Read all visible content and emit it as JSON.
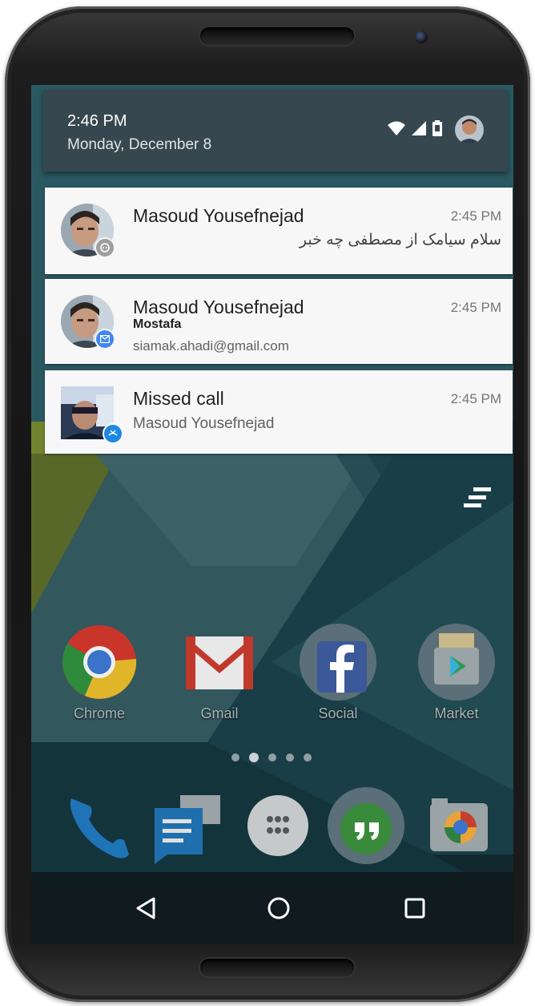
{
  "status_bar": {
    "time": "2:46 PM",
    "date": "Monday, December 8",
    "icons": [
      "wifi-icon",
      "signal-icon",
      "battery-icon",
      "user-avatar"
    ]
  },
  "notifications": [
    {
      "sender": "Masoud Yousefnejad",
      "time": "2:45 PM",
      "message": "سلام سیامک از مصطفی چه خبر",
      "badge_icon": "chat-bubble-icon",
      "badge_color": "#9e9e9e"
    },
    {
      "sender": "Masoud Yousefnejad",
      "time": "2:45 PM",
      "subject": "Mostafa",
      "email": "siamak.ahadi@gmail.com",
      "badge_icon": "mail-icon",
      "badge_color": "#4285f4"
    },
    {
      "title": "Missed call",
      "time": "2:45 PM",
      "caller": "Masoud Yousefnejad",
      "badge_icon": "missed-call-icon",
      "badge_color": "#1e88e5"
    }
  ],
  "home_apps": [
    {
      "label": "Chrome",
      "icon": "chrome-icon"
    },
    {
      "label": "Gmail",
      "icon": "gmail-icon"
    },
    {
      "label": "Social",
      "icon": "social-folder-icon"
    },
    {
      "label": "Market",
      "icon": "market-folder-icon"
    }
  ],
  "page_indicator": {
    "count": 5,
    "active": 1
  },
  "dock": [
    "phone-icon",
    "messaging-icon",
    "app-drawer-icon",
    "hangouts-icon",
    "camera-icon"
  ],
  "navigation": [
    "back-button",
    "home-button",
    "recents-button"
  ],
  "colors": {
    "status_bar": "#37474f",
    "notification_bg": "#f7f7f7",
    "wallpaper_base": "#1f4a54"
  }
}
